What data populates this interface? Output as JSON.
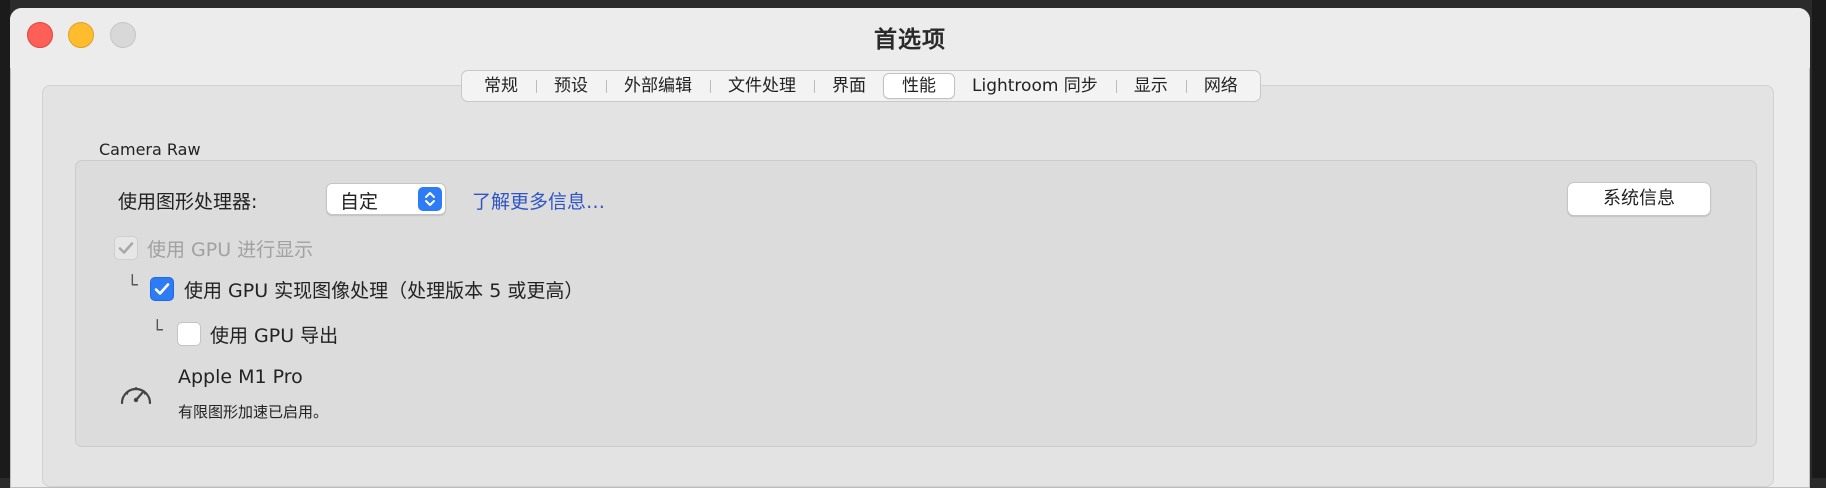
{
  "window": {
    "title": "首选项"
  },
  "tabs": [
    {
      "label": "常规",
      "active": false
    },
    {
      "label": "预设",
      "active": false
    },
    {
      "label": "外部编辑",
      "active": false
    },
    {
      "label": "文件处理",
      "active": false
    },
    {
      "label": "界面",
      "active": false
    },
    {
      "label": "性能",
      "active": true
    },
    {
      "label": "Lightroom 同步",
      "active": false
    },
    {
      "label": "显示",
      "active": false
    },
    {
      "label": "网络",
      "active": false
    }
  ],
  "camera_raw": {
    "section_label": "Camera Raw",
    "gpu_label": "使用图形处理器:",
    "gpu_select_value": "自定",
    "learn_more": "了解更多信息…",
    "system_info_button": "系统信息",
    "options": {
      "display": {
        "label": "使用 GPU 进行显示",
        "checked": true,
        "enabled": false
      },
      "image_processing": {
        "label": "使用 GPU 实现图像处理（处理版本 5 或更高）",
        "checked": true,
        "enabled": true
      },
      "export": {
        "label": "使用 GPU 导出",
        "checked": false,
        "enabled": true
      }
    },
    "tree_marker": "└",
    "gpu_name": "Apple M1 Pro",
    "gpu_status": "有限图形加速已启用。"
  },
  "colors": {
    "accent": "#2d7cf6",
    "link": "#2f55c7"
  },
  "icons": [
    "close-button",
    "minimize-button",
    "maximize-button",
    "chevron-updown-icon",
    "checkmark-icon",
    "speedometer-icon"
  ]
}
